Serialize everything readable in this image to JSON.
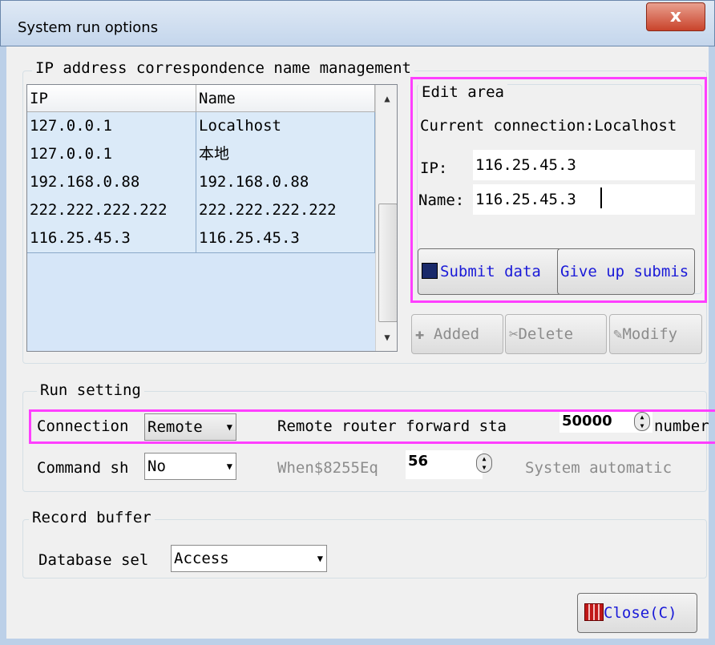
{
  "window": {
    "title": "System run options",
    "close_glyph": "x"
  },
  "ip_group": {
    "legend": "IP address correspondence name management",
    "columns": [
      "IP",
      "Name"
    ],
    "rows": [
      {
        "ip": "127.0.0.1",
        "name": "Localhost"
      },
      {
        "ip": "127.0.0.1",
        "name": "本地"
      },
      {
        "ip": "192.168.0.88",
        "name": "192.168.0.88"
      },
      {
        "ip": "222.222.222.222",
        "name": "222.222.222.222"
      },
      {
        "ip": "116.25.45.3",
        "name": "116.25.45.3"
      }
    ]
  },
  "edit_area": {
    "legend": "Edit area",
    "current_connection": "Current connection:Localhost",
    "ip_label": "IP:",
    "ip_value": "116.25.45.3",
    "name_label": "Name:",
    "name_value": "116.25.45.3",
    "submit_label": "Submit data",
    "give_up_label": "Give up submis"
  },
  "actions": {
    "add": "Added",
    "delete": "Delete",
    "modify": "Modify"
  },
  "run_setting": {
    "legend": "Run setting",
    "connection_label": "Connection",
    "connection_value": "Remote",
    "forward_label": "Remote router forward sta",
    "forward_value": "50000",
    "number_label": "number",
    "command_label": "Command sh",
    "command_value": "No",
    "when_label": "When$8255Eq",
    "when_value": "56",
    "auto_label": "System automatic"
  },
  "record_buffer": {
    "legend": "Record buffer",
    "database_label": "Database sel",
    "database_value": "Access"
  },
  "close_button": {
    "label": "Close(C)"
  },
  "colors": {
    "highlight": "#ff3fff",
    "selection": "#dbeaf8",
    "link_blue": "#1a1ad8"
  }
}
